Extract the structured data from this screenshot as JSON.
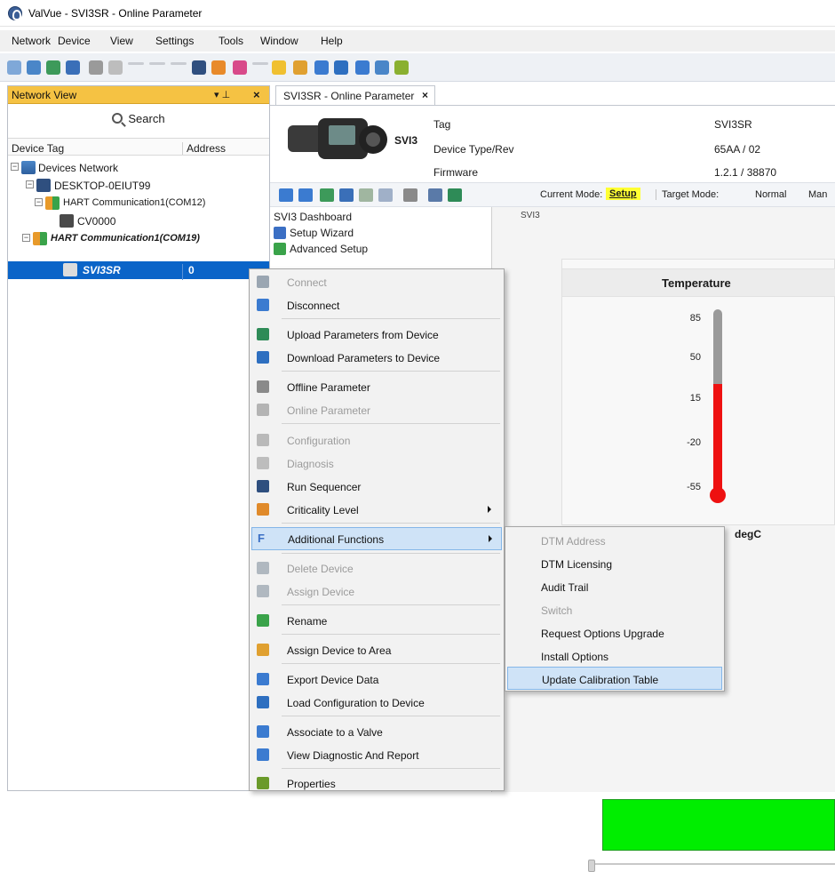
{
  "window": {
    "title": "ValVue - SVI3SR  - Online Parameter"
  },
  "menu": [
    "Network",
    "Device",
    "View",
    "Settings",
    "Tools",
    "Window",
    "Help"
  ],
  "network_view": {
    "title": "Network View",
    "search_label": "Search",
    "columns": {
      "tag": "Device Tag",
      "address": "Address"
    },
    "tree": [
      {
        "label": "Devices Network"
      },
      {
        "label": "DESKTOP-0EIUT99"
      },
      {
        "label": "HART Communication1(COM12)"
      },
      {
        "label": "CV0000"
      },
      {
        "label": "HART Communication1(COM19)"
      },
      {
        "label": "SVI3SR",
        "address": "0"
      }
    ]
  },
  "document": {
    "tab_label": "SVI3SR  - Online Parameter",
    "device_model": "SVI3",
    "info": [
      {
        "label": "Tag",
        "value": "SVI3SR"
      },
      {
        "label": "Device Type/Rev",
        "value": "65AA / 02"
      },
      {
        "label": "Firmware",
        "value": "1.2.1 / 38870"
      }
    ],
    "current_mode_label": "Current Mode:",
    "current_mode_value": "Setup",
    "target_mode_label": "Target Mode:",
    "target_mode_value": "Normal",
    "target_mode_extra": "Man",
    "nav": [
      "SVI3 Dashboard",
      "Setup Wizard",
      "Advanced Setup"
    ],
    "dashboard_caption": "SVI3",
    "temperature": {
      "title": "Temperature",
      "unit": "degC",
      "ticks": [
        "85",
        "50",
        "15",
        "-20",
        "-55"
      ]
    }
  },
  "context_menu": {
    "items": [
      {
        "label": "Connect",
        "enabled": false,
        "icon": "connect-icon",
        "color": "#9aa6b2"
      },
      {
        "label": "Disconnect",
        "enabled": true,
        "icon": "disconnect-icon",
        "color": "#3b7bd0"
      },
      {
        "label": "Upload Parameters from Device",
        "enabled": true,
        "icon": "upload-icon",
        "color": "#2e8b57"
      },
      {
        "label": "Download Parameters to Device",
        "enabled": true,
        "icon": "download-icon",
        "color": "#2e6fc0"
      },
      {
        "label": "Offline Parameter",
        "enabled": true,
        "icon": "offline-parameter-icon",
        "color": "#8a8a8a"
      },
      {
        "label": "Online Parameter",
        "enabled": false,
        "icon": "online-parameter-icon",
        "color": "#b4b4b4"
      },
      {
        "label": "Configuration",
        "enabled": false,
        "icon": "configuration-icon",
        "color": "#b9b9b9"
      },
      {
        "label": "Diagnosis",
        "enabled": false,
        "icon": "diagnosis-icon",
        "color": "#bdbdbd"
      },
      {
        "label": "Run Sequencer",
        "enabled": true,
        "icon": "run-sequencer-icon",
        "color": "#2f4f7f"
      },
      {
        "label": "Criticality Level",
        "enabled": true,
        "icon": "criticality-level-icon",
        "color": "#e08a2a",
        "submenu": true
      },
      {
        "label": "Additional Functions",
        "enabled": true,
        "icon": "additional-functions-icon",
        "color": "#3b6fc4",
        "submenu": true
      },
      {
        "label": "Delete Device",
        "enabled": false,
        "icon": "delete-device-icon",
        "color": "#b0b8c0"
      },
      {
        "label": "Assign Device",
        "enabled": false,
        "icon": "assign-device-icon",
        "color": "#b0b8c0"
      },
      {
        "label": "Rename",
        "enabled": true,
        "icon": "rename-icon",
        "color": "#3aa34a"
      },
      {
        "label": "Assign Device to Area",
        "enabled": true,
        "icon": "assign-area-icon",
        "color": "#e0a030"
      },
      {
        "label": "Export Device Data",
        "enabled": true,
        "icon": "export-icon",
        "color": "#3b7bd0"
      },
      {
        "label": "Load Configuration to Device",
        "enabled": true,
        "icon": "load-configuration-icon",
        "color": "#2e6fc0"
      },
      {
        "label": "Associate to a Valve",
        "enabled": true,
        "icon": "associate-valve-icon",
        "color": "#3b7bd0"
      },
      {
        "label": "View Diagnostic And Report",
        "enabled": true,
        "icon": "view-diagnostic-icon",
        "color": "#3b7bd0"
      },
      {
        "label": "Properties",
        "enabled": true,
        "icon": "properties-icon",
        "color": "#6a9a2a"
      }
    ]
  },
  "submenu": {
    "items": [
      {
        "label": "DTM Address",
        "enabled": false
      },
      {
        "label": "DTM Licensing",
        "enabled": true
      },
      {
        "label": "Audit Trail",
        "enabled": true
      },
      {
        "label": "Switch",
        "enabled": false
      },
      {
        "label": "Request Options Upgrade",
        "enabled": true
      },
      {
        "label": "Install Options",
        "enabled": true
      },
      {
        "label": "Update Calibration Table",
        "enabled": true,
        "highlighted": true
      }
    ]
  },
  "colors": {
    "panel_header": "#f5c243",
    "selection": "#0a64c8",
    "menu_highlight": "#cfe3f7",
    "thermometer": "#ee1111",
    "status_bar": "#00ee00",
    "mode_highlight": "#ffff33"
  }
}
